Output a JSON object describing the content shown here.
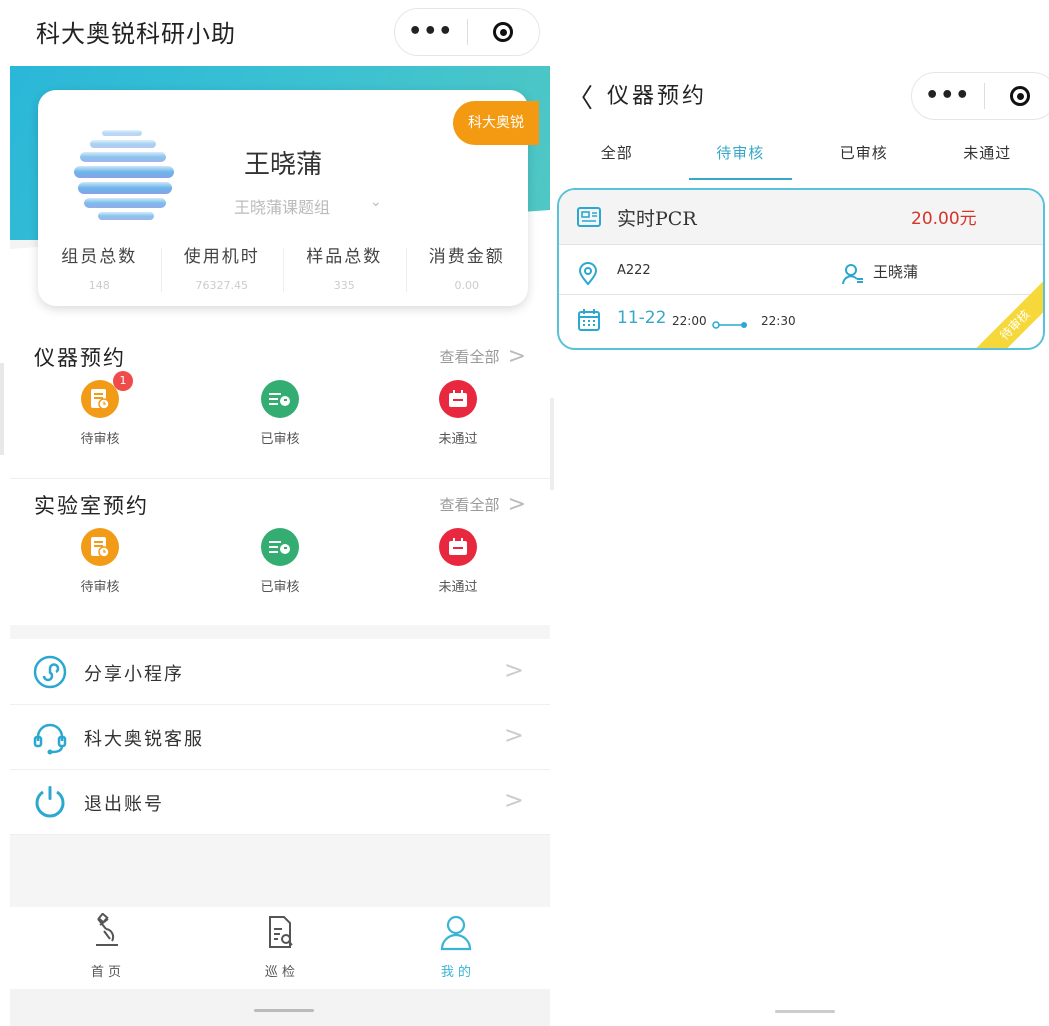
{
  "left": {
    "app_title": "科大奥锐科研小助",
    "capsule": {
      "more": "•••"
    },
    "profile": {
      "name": "王晓蒲",
      "group": "王晓蒲课题组",
      "group_chevron": "⌄",
      "org_badge": "科大奥锐",
      "stats": [
        {
          "label": "组员总数",
          "value": "148"
        },
        {
          "label": "使用机时",
          "value": "76327.45"
        },
        {
          "label": "样品总数",
          "value": "335"
        },
        {
          "label": "消费金额",
          "value": "0.00"
        }
      ]
    },
    "instrument_booking": {
      "title": "仪器预约",
      "view_all": "查看全部",
      "items": [
        {
          "label": "待审核",
          "badge": "1"
        },
        {
          "label": "已审核"
        },
        {
          "label": "未通过"
        }
      ]
    },
    "lab_booking": {
      "title": "实验室预约",
      "view_all": "查看全部",
      "items": [
        {
          "label": "待审核"
        },
        {
          "label": "已审核"
        },
        {
          "label": "未通过"
        }
      ]
    },
    "menu": [
      {
        "label": "分享小程序",
        "icon": "share-miniprogram-icon"
      },
      {
        "label": "科大奥锐客服",
        "icon": "headset-icon"
      },
      {
        "label": "退出账号",
        "icon": "power-icon"
      }
    ],
    "tabbar": [
      {
        "label": "首 页",
        "icon": "microscope-icon"
      },
      {
        "label": "巡 检",
        "icon": "document-search-icon"
      },
      {
        "label": "我 的",
        "icon": "user-icon",
        "active": true
      }
    ],
    "colors": {
      "accent": "#3ab4d6",
      "orange": "#f29b17",
      "green": "#34ad73",
      "red": "#e8283f"
    }
  },
  "right": {
    "back": "〈",
    "title": "仪器预约",
    "capsule": {
      "more": "•••"
    },
    "tabs": [
      "全部",
      "待审核",
      "已审核",
      "未通过"
    ],
    "active_tab": "待审核",
    "card": {
      "instrument": "实时PCR",
      "price": "20.00元",
      "location": "A222",
      "person": "王晓蒲",
      "date": "11-22",
      "start": "22:00",
      "end": "22:30",
      "status_ribbon": "待审核"
    }
  }
}
